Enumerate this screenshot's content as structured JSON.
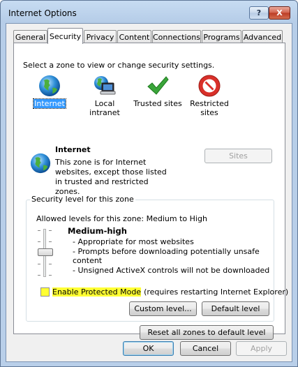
{
  "window": {
    "title": "Internet Options",
    "help_label": "?",
    "close_label": "X"
  },
  "tabs": [
    {
      "label": "General",
      "active": false
    },
    {
      "label": "Security",
      "active": true
    },
    {
      "label": "Privacy",
      "active": false
    },
    {
      "label": "Content",
      "active": false
    },
    {
      "label": "Connections",
      "active": false
    },
    {
      "label": "Programs",
      "active": false
    },
    {
      "label": "Advanced",
      "active": false
    }
  ],
  "security": {
    "instruction": "Select a zone to view or change security settings.",
    "zones": [
      {
        "label": "Internet",
        "icon": "globe-icon",
        "selected": true
      },
      {
        "label": "Local intranet",
        "icon": "intranet-icon",
        "selected": false
      },
      {
        "label": "Trusted sites",
        "icon": "checkmark-icon",
        "selected": false
      },
      {
        "label": "Restricted sites",
        "icon": "restricted-icon",
        "selected": false
      }
    ],
    "zone_info": {
      "title": "Internet",
      "description": "This zone is for Internet websites, except those listed in trusted and restricted zones.",
      "sites_label": "Sites"
    },
    "level_group": {
      "title": "Security level for this zone",
      "allowed": "Allowed levels for this zone: Medium to High",
      "level_name": "Medium-high",
      "bullets": [
        "- Appropriate for most websites",
        "- Prompts before downloading potentially unsafe content",
        "- Unsigned ActiveX controls will not be downloaded"
      ]
    },
    "protected_mode": {
      "label": "Enable Protected Mode",
      "note": "(requires restarting Internet Explorer)",
      "checked": false
    },
    "custom_level_label": "Custom level...",
    "default_level_label": "Default level",
    "reset_all_label": "Reset all zones to default level"
  },
  "footer": {
    "ok_label": "OK",
    "cancel_label": "Cancel",
    "apply_label": "Apply"
  },
  "colors": {
    "selection": "#3399ff",
    "highlight": "#ffff33",
    "restricted": "#d9302a",
    "trusted": "#3aa53a"
  }
}
